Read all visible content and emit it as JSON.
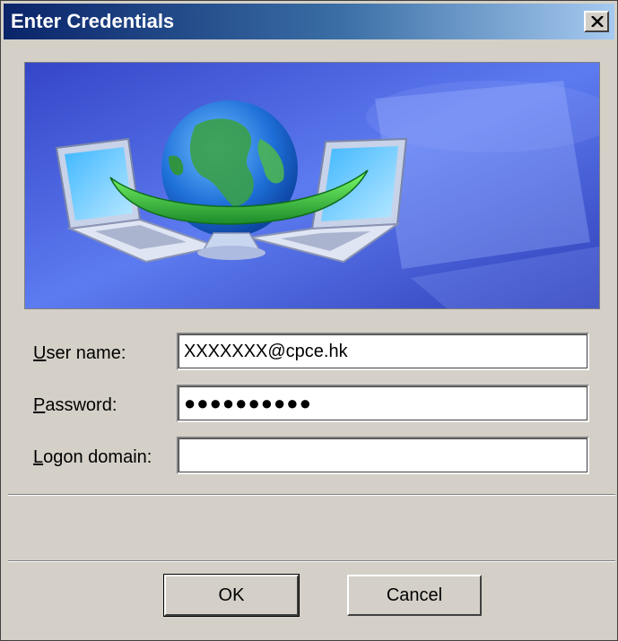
{
  "window": {
    "title": "Enter Credentials",
    "close_glyph": "✕"
  },
  "banner": {
    "icon": "network-connection-illustration",
    "colors": {
      "bg_dark": "#2a3fbf",
      "bg_light": "#8fa8ff",
      "globe_blue": "#1e6fd8",
      "globe_green": "#3aa04a"
    }
  },
  "form": {
    "username": {
      "label_accel": "U",
      "label_rest": "ser name:",
      "value": "XXXXXXX@cpce.hk"
    },
    "password": {
      "label_accel": "P",
      "label_rest": "assword:",
      "value": "●●●●●●●●●●"
    },
    "domain": {
      "label_accel": "L",
      "label_rest": "ogon domain:",
      "value": ""
    }
  },
  "buttons": {
    "ok": "OK",
    "cancel": "Cancel"
  }
}
